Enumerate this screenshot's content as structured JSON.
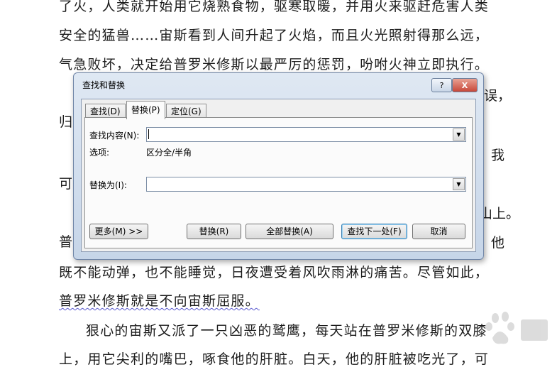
{
  "document": {
    "lines": [
      "了火，人类就开始用它烧熟食物，驱寒取暖，并用火来驱赶危害人类",
      "安全的猛兽……宙斯看到人间升起了火焰，而且火光照射得那么远，",
      "气急败坏，决定给普罗米修斯以最严厉的惩罚，吩咐火神立即执行。",
      "既不能动弹，也不能睡觉，日夜遭受着风吹雨淋的痛苦。尽管如此，",
      "普罗米修斯就是不向宙斯屈服。",
      "狠心的宙斯又派了一只凶恶的鹫鹰，每天站在普罗米修斯的双膝",
      "上，用它尖利的嘴巴，啄食他的肝脏。白天，他的肝脏被吃光了，可"
    ],
    "fragments": {
      "left_1": "归",
      "left_2": "可",
      "left_3": "普",
      "right_1": "误，",
      "right_2": "我",
      "right_3": "山上。",
      "right_4": "他"
    }
  },
  "dialog": {
    "title": "查找和替换",
    "help_label": "?",
    "close_label": "X",
    "tabs": [
      "查找(D)",
      "替换(P)",
      "定位(G)"
    ],
    "active_tab": "替换(P)",
    "find_label": "查找内容(N):",
    "find_value": "",
    "options_label": "选项:",
    "options_value": "区分全/半角",
    "replace_label": "替换为(I):",
    "replace_value": "",
    "buttons": {
      "more": "更多(M) >>",
      "replace": "替换(R)",
      "replace_all": "全部替换(A)",
      "find_next": "查找下一处(F)",
      "cancel": "取消"
    }
  },
  "colors": {
    "dialog_frame": "#c6d5e8",
    "close_button": "#c7483a"
  },
  "watermark_icon": "baidu-paw-icon"
}
